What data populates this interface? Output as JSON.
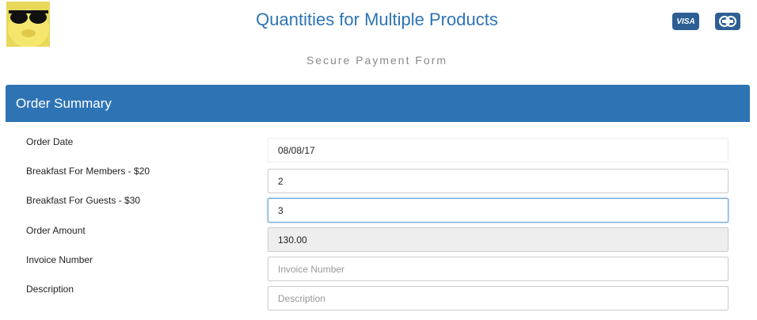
{
  "header": {
    "title": "Quantities for Multiple Products",
    "subtitle": "Secure Payment Form",
    "cards": {
      "visa": "VISA",
      "mastercard": ""
    }
  },
  "panel": {
    "title": "Order Summary"
  },
  "form": {
    "order_date": {
      "label": "Order Date",
      "value": "08/08/17"
    },
    "members": {
      "label": "Breakfast For Members - $20",
      "value": "2"
    },
    "guests": {
      "label": "Breakfast For Guests - $30",
      "value": "3"
    },
    "amount": {
      "label": "Order Amount",
      "value": "130.00"
    },
    "invoice": {
      "label": "Invoice Number",
      "placeholder": "Invoice Number"
    },
    "description": {
      "label": "Description",
      "placeholder": "Description"
    }
  }
}
